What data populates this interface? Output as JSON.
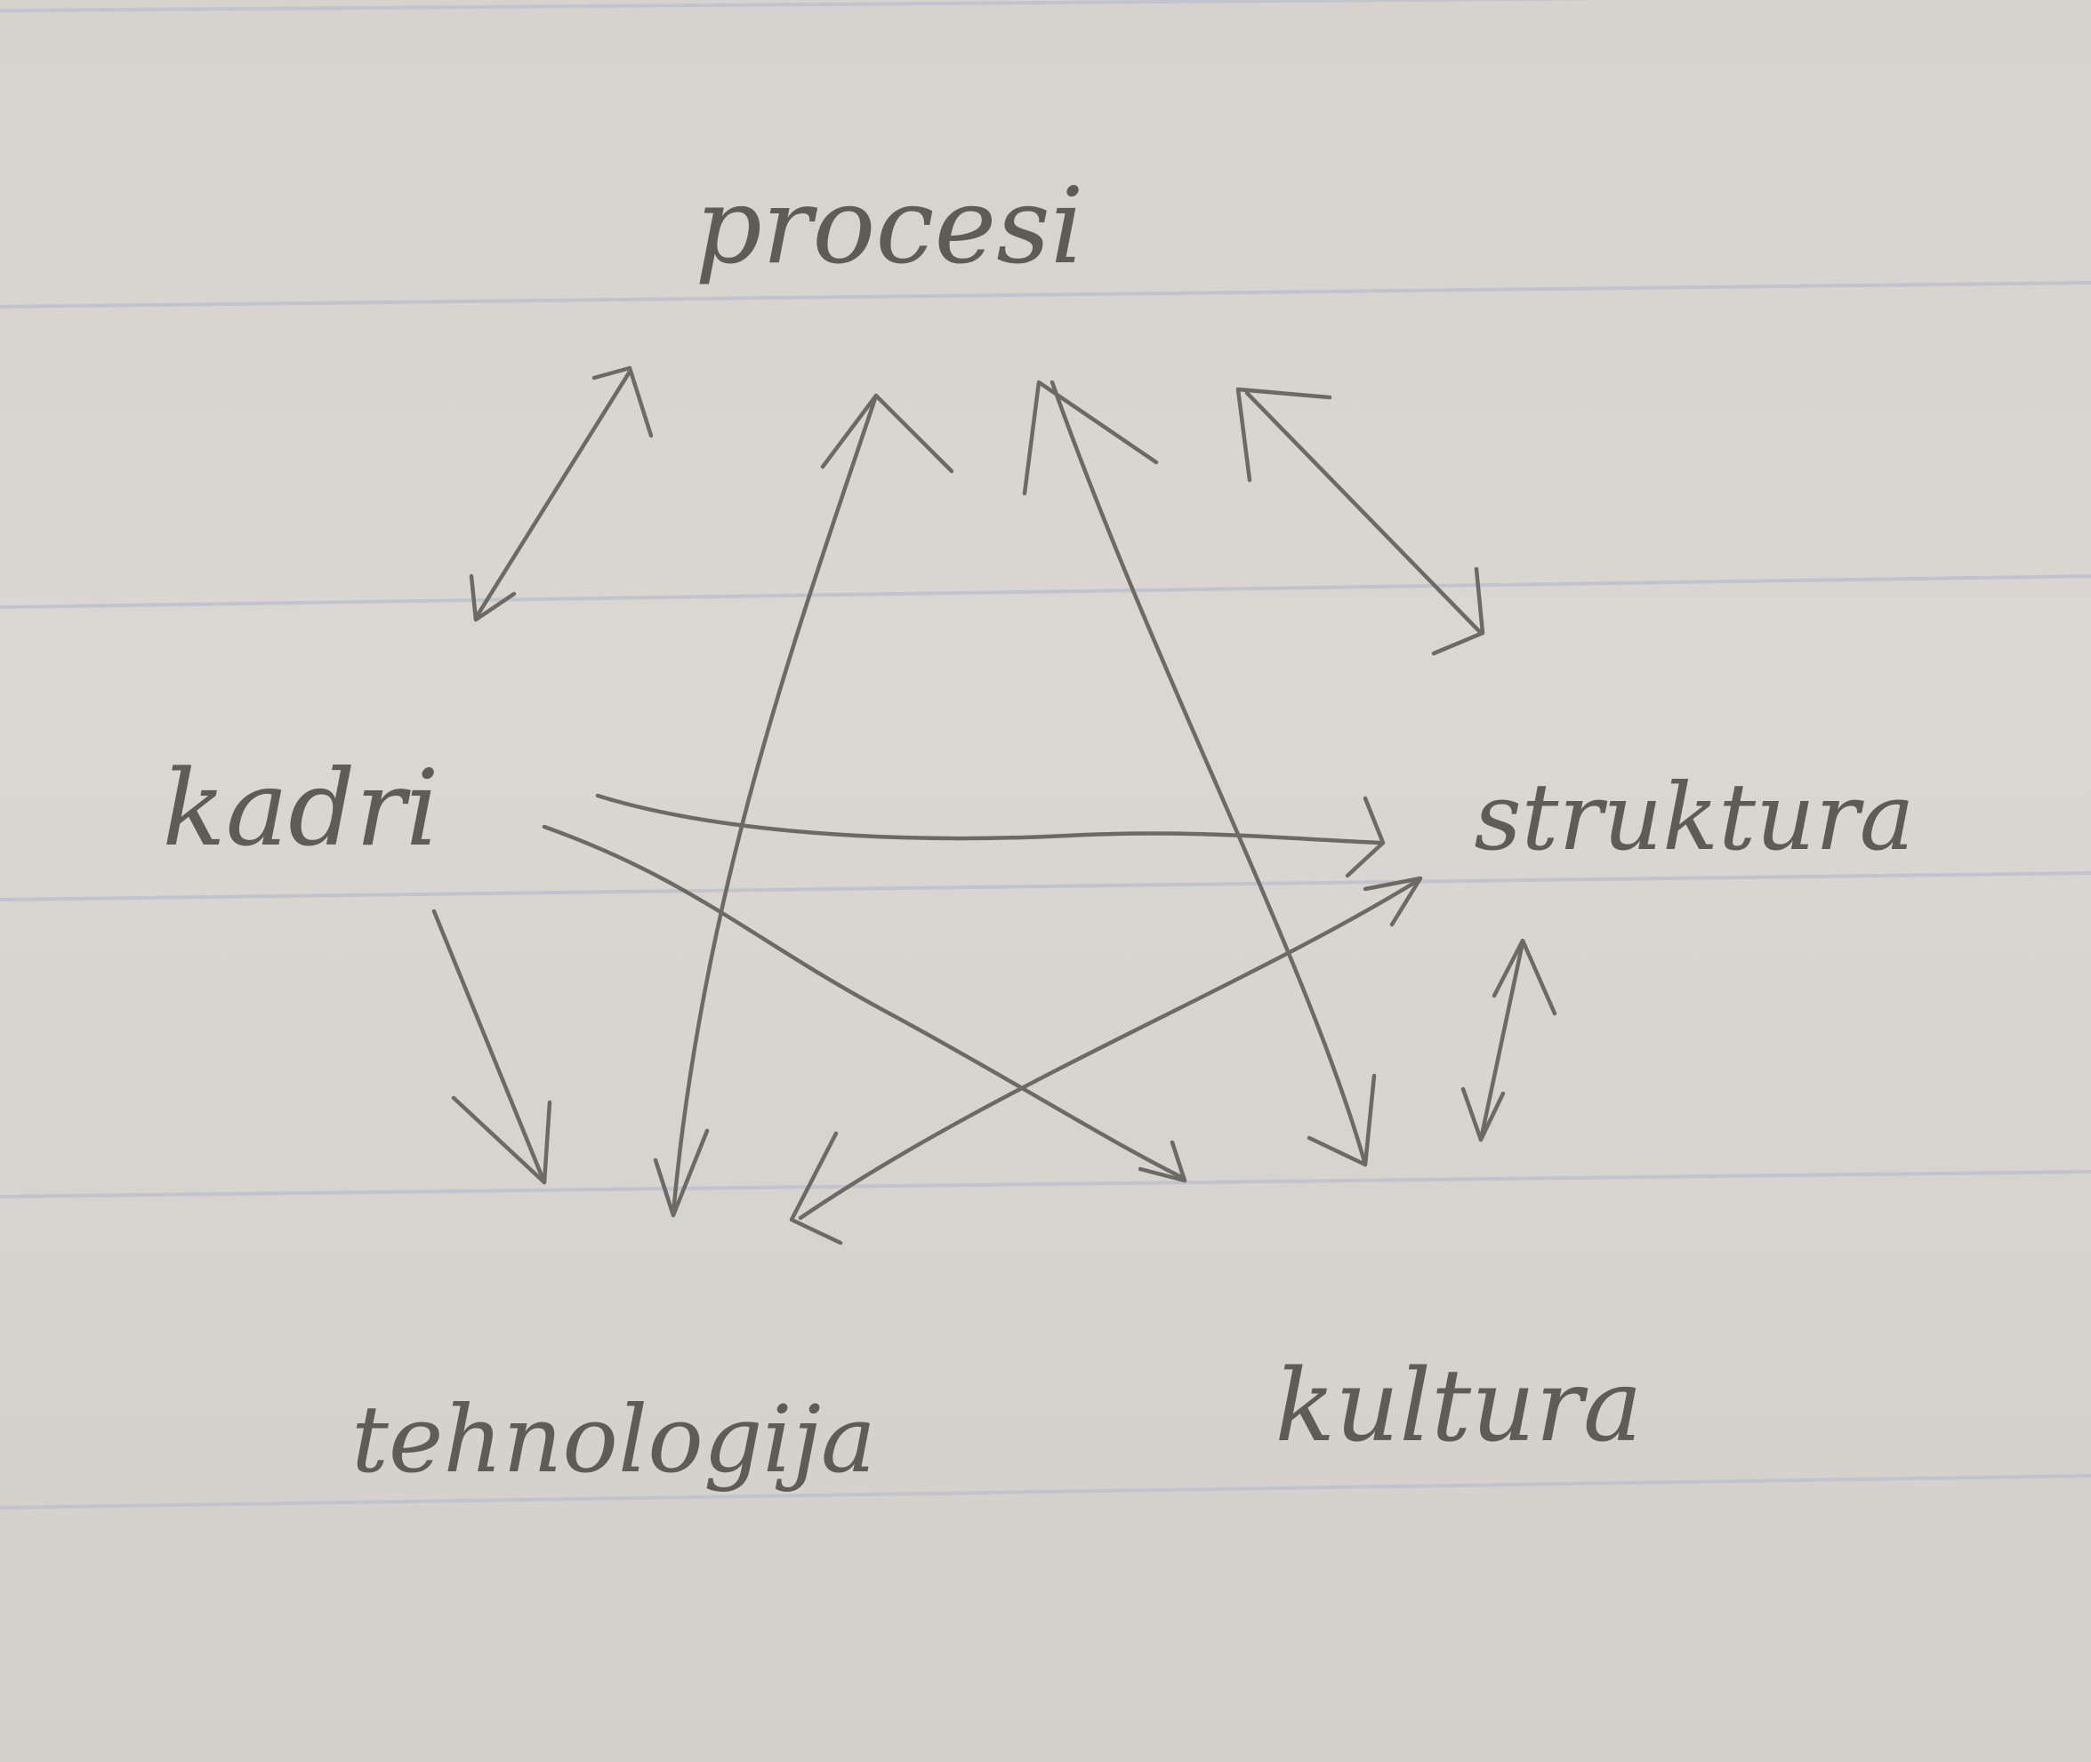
{
  "diagram": {
    "nodes": [
      {
        "id": "procesi",
        "label": "procesi"
      },
      {
        "id": "struktura",
        "label": "struktura"
      },
      {
        "id": "kultura",
        "label": "kultura"
      },
      {
        "id": "tehnologija",
        "label": "tehnologija"
      },
      {
        "id": "kadri",
        "label": "kadri"
      }
    ],
    "edges": [
      {
        "from": "kadri",
        "to": "procesi",
        "direction": "both"
      },
      {
        "from": "tehnologija",
        "to": "procesi",
        "direction": "both"
      },
      {
        "from": "kultura",
        "to": "procesi",
        "direction": "both"
      },
      {
        "from": "struktura",
        "to": "procesi",
        "direction": "both"
      },
      {
        "from": "kadri",
        "to": "struktura",
        "direction": "forward"
      },
      {
        "from": "kadri",
        "to": "kultura",
        "direction": "forward"
      },
      {
        "from": "kadri",
        "to": "tehnologija",
        "direction": "forward"
      },
      {
        "from": "struktura",
        "to": "tehnologija",
        "direction": "both"
      },
      {
        "from": "struktura",
        "to": "kultura",
        "direction": "both"
      }
    ]
  }
}
